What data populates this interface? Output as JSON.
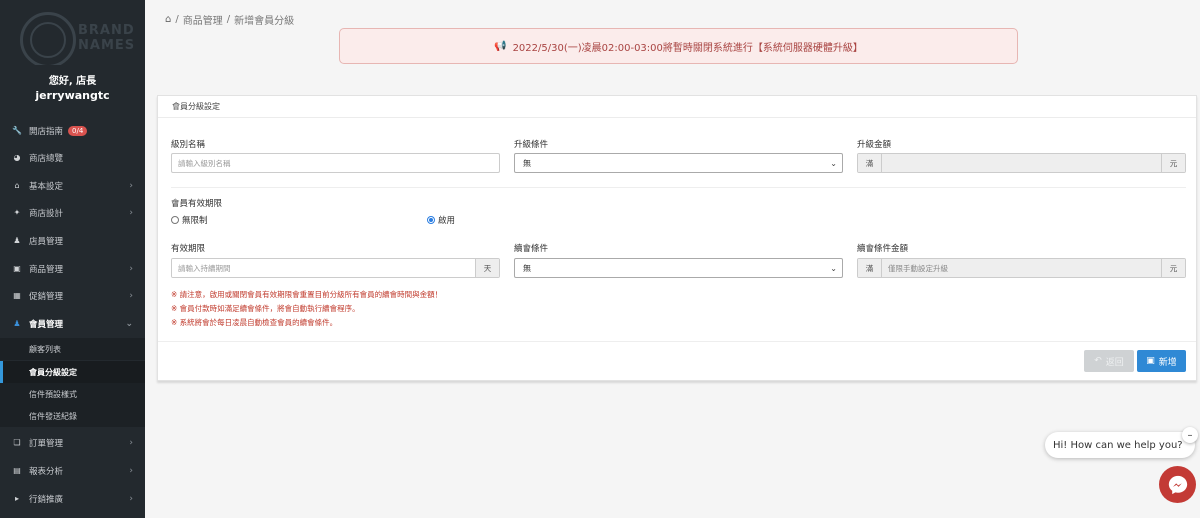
{
  "sidebar": {
    "logo_text": [
      "BRAND",
      "NAMES"
    ],
    "greeting": "您好, 店長",
    "username": "jerrywangtc",
    "items": [
      {
        "label": "開店指南",
        "icon": "wrench-icon",
        "badge": "0/4",
        "has_chevron": false
      },
      {
        "label": "商店總覽",
        "icon": "dashboard-icon",
        "has_chevron": false
      },
      {
        "label": "基本設定",
        "icon": "bank-icon",
        "has_chevron": true
      },
      {
        "label": "商店設計",
        "icon": "magic-wand-icon",
        "has_chevron": true
      },
      {
        "label": "店員管理",
        "icon": "user-icon",
        "has_chevron": false
      },
      {
        "label": "商品管理",
        "icon": "cart-icon",
        "has_chevron": true
      },
      {
        "label": "促銷管理",
        "icon": "gift-icon",
        "has_chevron": true
      },
      {
        "label": "會員管理",
        "icon": "users-icon",
        "has_chevron": true,
        "expanded": true
      },
      {
        "label": "訂單管理",
        "icon": "copy-icon",
        "has_chevron": true
      },
      {
        "label": "報表分析",
        "icon": "bar-chart-icon",
        "has_chevron": true
      },
      {
        "label": "行銷推廣",
        "icon": "bullhorn-icon",
        "has_chevron": true
      }
    ],
    "subitems": [
      {
        "label": "顧客列表"
      },
      {
        "label": "會員分級設定",
        "current": true
      },
      {
        "label": "信件預設樣式"
      },
      {
        "label": "信件發送紀錄"
      }
    ]
  },
  "breadcrumb": {
    "sep": "/",
    "items": [
      "商品管理",
      "新增會員分級"
    ]
  },
  "notice": {
    "text": "2022/5/30(一)凌晨02:00-03:00將暫時關閉系統進行【系統伺服器硬體升級】",
    "icon": "bullhorn-icon"
  },
  "panel": {
    "title": "會員分級設定",
    "level_name_label": "級別名稱",
    "level_name_placeholder": "請輸入級別名稱",
    "upgrade_condition_label": "升級條件",
    "upgrade_condition_value": "無",
    "upgrade_amount_label": "升級金額",
    "upgrade_amount_prefix": "滿",
    "upgrade_amount_suffix": "元",
    "validity_section_label": "會員有效期限",
    "radio_unlimited": "無限制",
    "radio_enabled": "啟用",
    "selected_radio": "啟用",
    "validity_label": "有效期限",
    "validity_placeholder": "請輸入持續期間",
    "validity_suffix": "天",
    "renew_condition_label": "續會條件",
    "renew_condition_value": "無",
    "renew_amount_label": "續會條件金額",
    "renew_amount_prefix": "滿",
    "renew_amount_placeholder": "僅限手動設定升級",
    "renew_amount_suffix": "元",
    "notes": [
      "※ 請注意，啟用或關閉會員有效期限會重置目前分級所有會員的續會時間與金額！",
      "※ 會員付款時如滿足續會條件，將會自動執行續會程序。",
      "※ 系統將會於每日凌晨自動檢查會員的續會條件。"
    ],
    "back_button": "返回",
    "add_button": "新增"
  },
  "chat": {
    "bubble_text": "Hi! How can we help you?",
    "close_label": "–"
  },
  "colors": {
    "sidebar_bg": "#23292e",
    "primary_button": "#2f89d5",
    "notice_text": "#a94442",
    "note_text": "#c0392b",
    "chat_button": "#c33a35"
  }
}
